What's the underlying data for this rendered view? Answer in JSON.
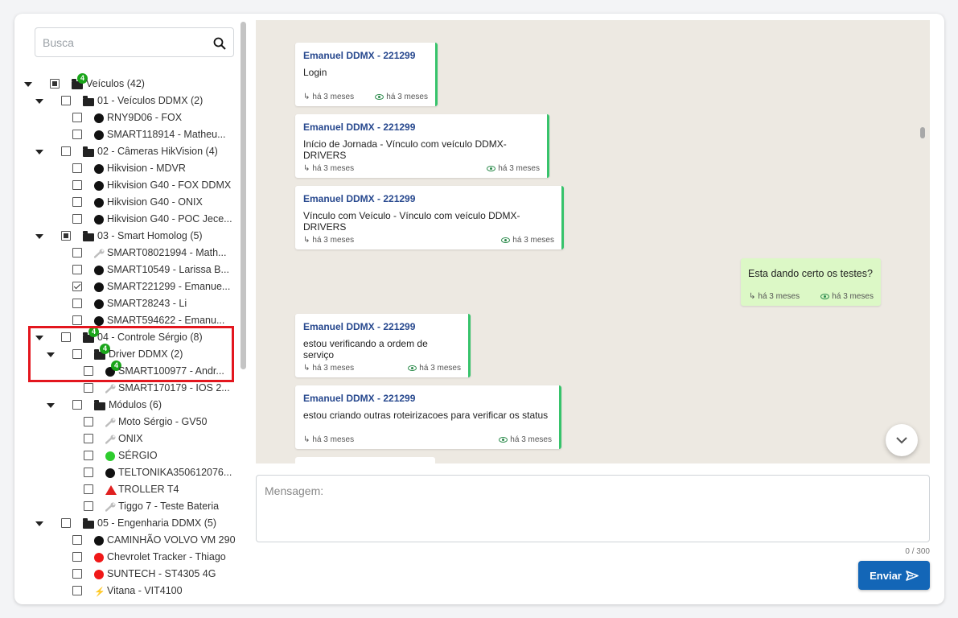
{
  "search": {
    "placeholder": "Busca"
  },
  "tree": [
    {
      "label": "Veículos (42)",
      "level": 0,
      "caret": true,
      "check": "partial",
      "icon": "folder-icon",
      "badge": "4"
    },
    {
      "label": "01 - Veículos DDMX (2)",
      "level": 1,
      "caret": true,
      "check": "none",
      "icon": "folder-icon"
    },
    {
      "label": "RNY9D06 - FOX",
      "level": 2,
      "check": "none",
      "icon": "black-dot-icon"
    },
    {
      "label": "SMART118914 - Matheu...",
      "level": 2,
      "check": "none",
      "icon": "black-dot-icon"
    },
    {
      "label": "02 - Câmeras HikVision (4)",
      "level": 1,
      "caret": true,
      "check": "none",
      "icon": "folder-icon"
    },
    {
      "label": "Hikvision - MDVR",
      "level": 2,
      "check": "none",
      "icon": "black-dot-icon"
    },
    {
      "label": "Hikvision G40 - FOX DDMX",
      "level": 2,
      "check": "none",
      "icon": "black-dot-icon"
    },
    {
      "label": "Hikvision G40 - ONIX",
      "level": 2,
      "check": "none",
      "icon": "black-dot-icon"
    },
    {
      "label": "Hikvision G40 - POC Jece...",
      "level": 2,
      "check": "none",
      "icon": "black-dot-icon"
    },
    {
      "label": "03 - Smart Homolog (5)",
      "level": 1,
      "caret": true,
      "check": "partial",
      "icon": "folder-icon"
    },
    {
      "label": "SMART08021994 - Math...",
      "level": 2,
      "check": "none",
      "icon": "wrench-icon"
    },
    {
      "label": "SMART10549 - Larissa B...",
      "level": 2,
      "check": "none",
      "icon": "black-dot-icon"
    },
    {
      "label": "SMART221299 - Emanue...",
      "level": 2,
      "check": "checked",
      "icon": "black-dot-icon"
    },
    {
      "label": "SMART28243 - Li",
      "level": 2,
      "check": "none",
      "icon": "black-dot-icon"
    },
    {
      "label": "SMART594622 - Emanu...",
      "level": 2,
      "check": "none",
      "icon": "black-dot-icon"
    },
    {
      "label": "04 - Controle Sérgio (8)",
      "level": 1,
      "caret": true,
      "check": "none",
      "icon": "folder-icon",
      "badge": "4"
    },
    {
      "label": "Driver DDMX (2)",
      "level": 2,
      "caret": true,
      "check": "none",
      "icon": "folder-icon",
      "badge": "4"
    },
    {
      "label": "SMART100977 - Andr...",
      "level": 3,
      "check": "none",
      "icon": "black-dot-icon",
      "badge": "4"
    },
    {
      "label": "SMART170179 - IOS 2...",
      "level": 3,
      "check": "none",
      "icon": "wrench-icon"
    },
    {
      "label": "Módulos (6)",
      "level": 2,
      "caret": true,
      "check": "none",
      "icon": "folder-icon"
    },
    {
      "label": "Moto Sérgio - GV50",
      "level": 3,
      "check": "none",
      "icon": "wrench-icon"
    },
    {
      "label": "ONIX",
      "level": 3,
      "check": "none",
      "icon": "wrench-icon"
    },
    {
      "label": "SÉRGIO",
      "level": 3,
      "check": "none",
      "icon": "green-dot-icon"
    },
    {
      "label": "TELTONIKA350612076...",
      "level": 3,
      "check": "none",
      "icon": "black-dot-icon"
    },
    {
      "label": "TROLLER T4",
      "level": 3,
      "check": "none",
      "icon": "warning-icon"
    },
    {
      "label": "Tiggo 7 - Teste Bateria",
      "level": 3,
      "check": "none",
      "icon": "wrench-icon"
    },
    {
      "label": "05 - Engenharia DDMX (5)",
      "level": 1,
      "caret": true,
      "check": "none",
      "icon": "folder-icon"
    },
    {
      "label": "CAMINHÃO VOLVO VM 290",
      "level": 2,
      "check": "none",
      "icon": "black-dot-icon"
    },
    {
      "label": "Chevrolet Tracker - Thiago",
      "level": 2,
      "check": "none",
      "icon": "red-dot-icon"
    },
    {
      "label": "SUNTECH - ST4305 4G",
      "level": 2,
      "check": "none",
      "icon": "red-dot-icon"
    },
    {
      "label": "Vitana - VIT4100",
      "level": 2,
      "check": "none",
      "icon": "bolt-icon"
    }
  ],
  "messages": [
    {
      "sender": "Emanuel DDMX - 221299",
      "text": "Login",
      "sent": "há 3 meses",
      "seen": "há 3 meses",
      "direction": "in"
    },
    {
      "sender": "Emanuel DDMX - 221299",
      "text": "Início de Jornada - Vínculo com veículo DDMX-DRIVERS",
      "sent": "há 3 meses",
      "seen": "há 3 meses",
      "direction": "in"
    },
    {
      "sender": "Emanuel DDMX - 221299",
      "text": "Vínculo com Veículo - Vínculo com veículo DDMX-DRIVERS",
      "sent": "há 3 meses",
      "seen": "há 3 meses",
      "direction": "in"
    },
    {
      "sender": "",
      "text": "Esta dando certo os testes?",
      "sent": "há 3 meses",
      "seen": "há 3 meses",
      "direction": "out"
    },
    {
      "sender": "Emanuel DDMX - 221299",
      "text": "estou verificando a ordem de serviço",
      "sent": "há 3 meses",
      "seen": "há 3 meses",
      "direction": "in"
    },
    {
      "sender": "Emanuel DDMX - 221299",
      "text": "estou criando outras roteirizacoes para verificar os status",
      "sent": "há 3 meses",
      "seen": "há 3 meses",
      "direction": "in"
    }
  ],
  "composer": {
    "placeholder": "Mensagem:",
    "counter": "0 / 300",
    "send_label": "Enviar"
  },
  "colors": {
    "accent": "#1366b7",
    "sender": "#27488e",
    "outgoing_bg": "#dcf8c6",
    "incoming_border": "#37c36b",
    "highlight": "#e3161e"
  }
}
